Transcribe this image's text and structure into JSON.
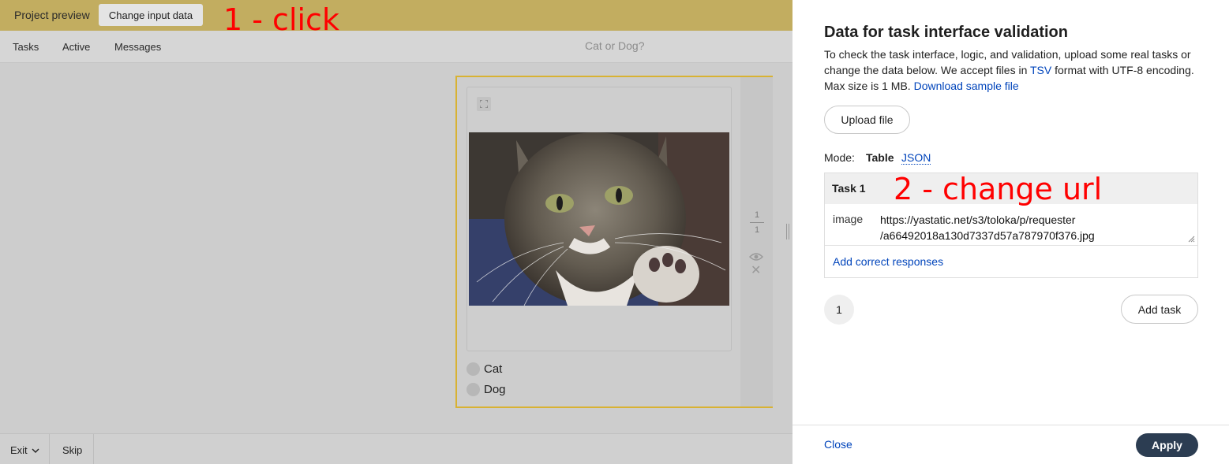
{
  "topbar": {
    "title": "Project preview",
    "change_input_label": "Change input data"
  },
  "annotations": {
    "step1": "1 - click",
    "step2": "2 - change url"
  },
  "navbar": {
    "items": [
      {
        "label": "Tasks"
      },
      {
        "label": "Active"
      },
      {
        "label": "Messages"
      }
    ],
    "project_name": "Cat or Dog?"
  },
  "task_preview": {
    "page_current": "1",
    "page_total": "1",
    "options": [
      {
        "label": "Cat"
      },
      {
        "label": "Dog"
      }
    ]
  },
  "bottombar": {
    "exit_label": "Exit",
    "skip_label": "Skip"
  },
  "panel": {
    "title": "Data for task interface validation",
    "desc_prefix": "To check the task interface, logic, and validation, upload some real tasks or change the data below. We accept files in ",
    "desc_tsv": "TSV",
    "desc_middle": " format with UTF-8 encoding. Max size is 1 MB. ",
    "desc_download": "Download sample file",
    "upload_label": "Upload file",
    "mode_label": "Mode:",
    "mode_table": "Table",
    "mode_json": "JSON",
    "task": {
      "header": "Task 1",
      "field_name": "image",
      "field_value": "https://yastatic.net/s3/toloka/p/requester\n/a66492018a130d7337d57a787970f376.jpg",
      "add_correct": "Add correct responses"
    },
    "page_number": "1",
    "add_task_label": "Add task",
    "close_label": "Close",
    "apply_label": "Apply"
  },
  "colors": {
    "topbar": "#c2ad60",
    "accent_border": "#d8b233",
    "link": "#0044bb",
    "apply_button": "#2c3d52",
    "annotation": "#ff0000"
  }
}
